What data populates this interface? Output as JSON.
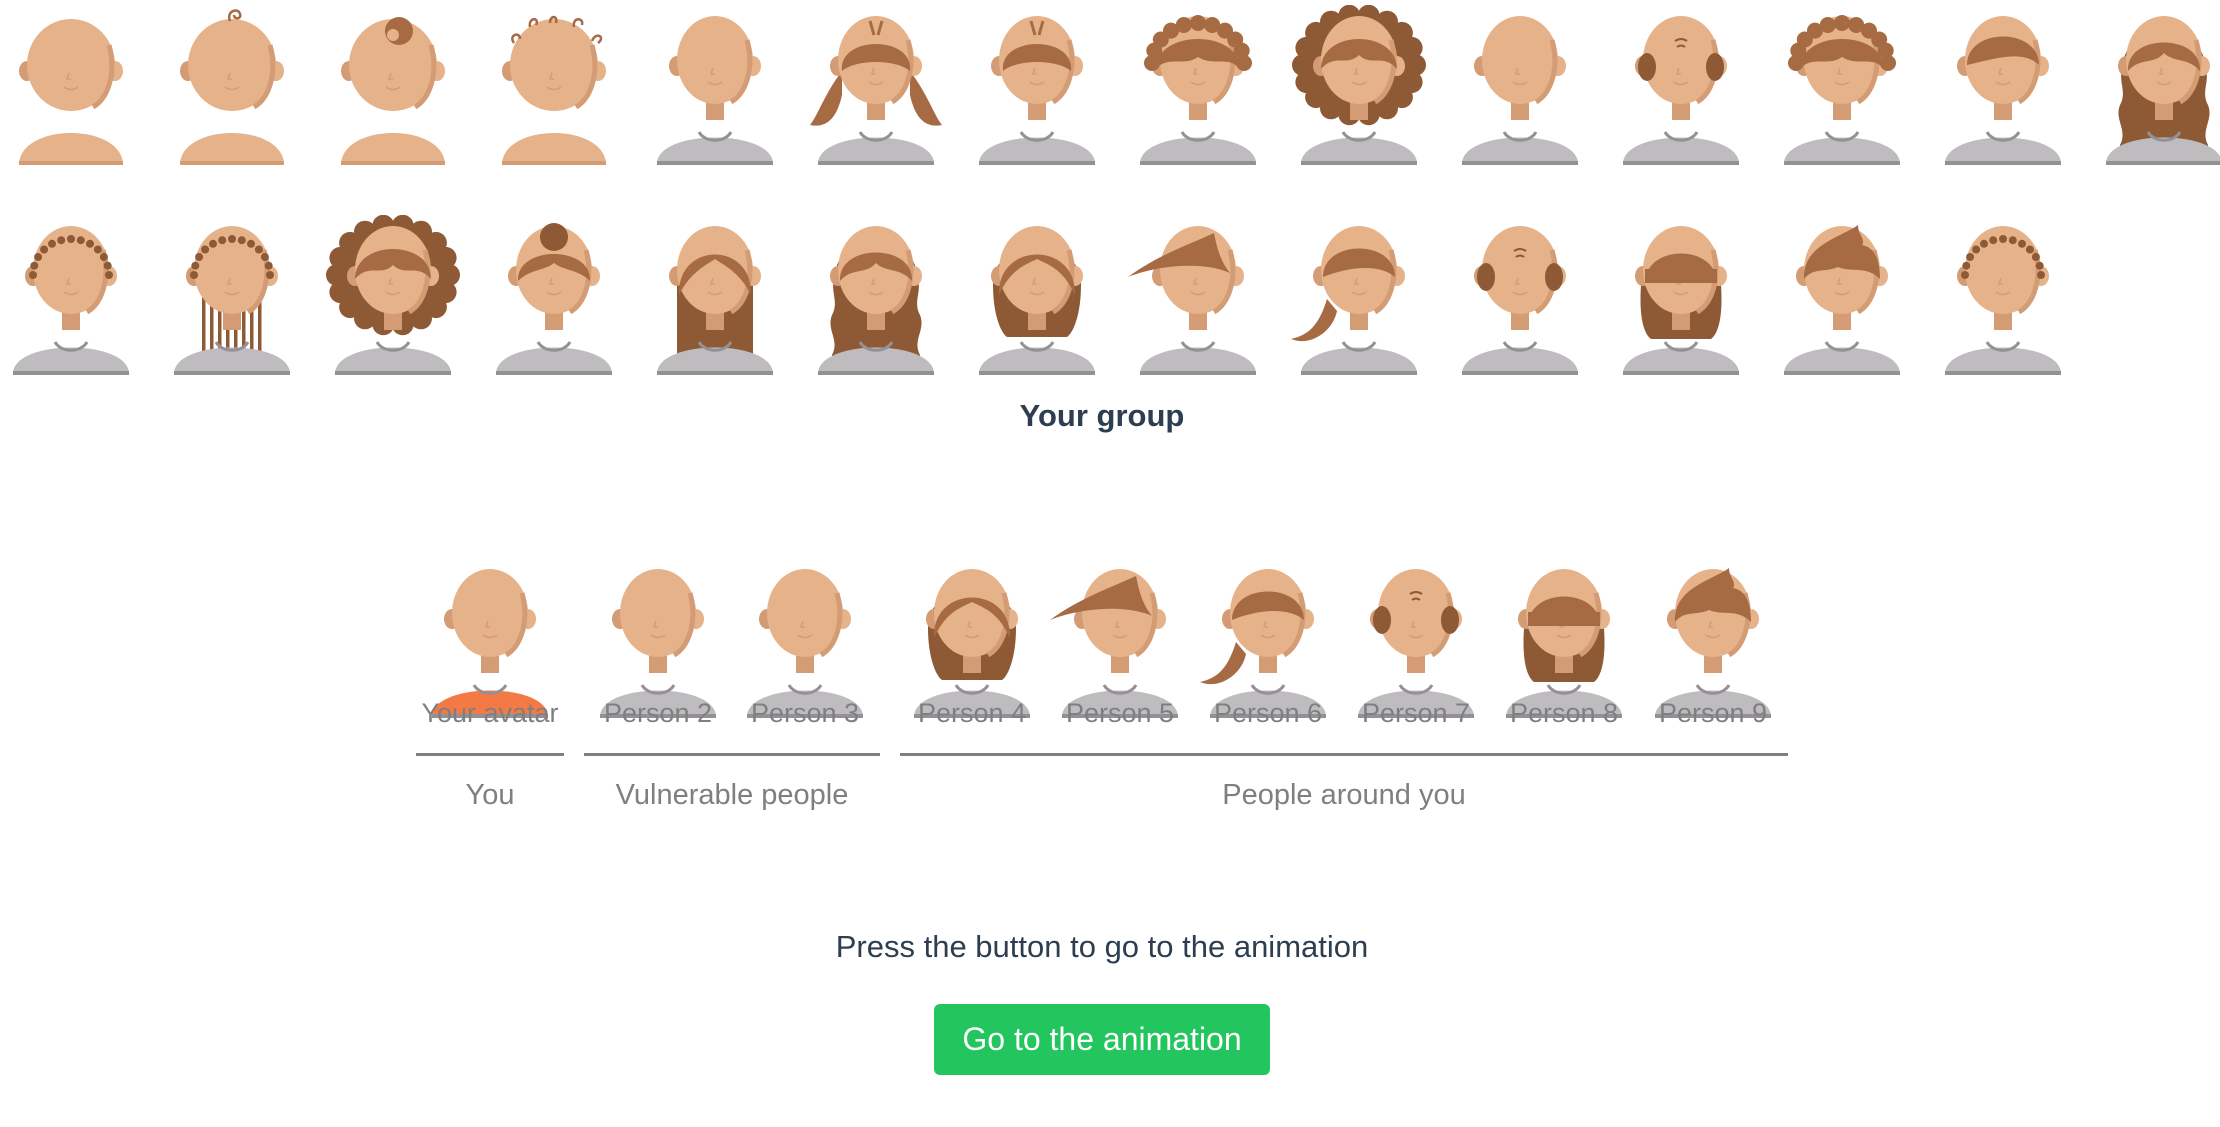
{
  "colors": {
    "skin": "#e5b28a",
    "skin_shadow": "#d49c74",
    "hair": "#a66b43",
    "hair_dark": "#8e5a36",
    "shirt": "#bfbcc0",
    "shirt_shadow": "#949196",
    "you_shirt": "#f47a45",
    "text_dark": "#2c3e50",
    "text_grey": "#7f7f7f",
    "button": "#22c55e"
  },
  "picker": {
    "row1": [
      {
        "hair": "none",
        "body": "baby"
      },
      {
        "hair": "curl",
        "body": "baby"
      },
      {
        "hair": "topknot",
        "body": "baby"
      },
      {
        "hair": "curls",
        "body": "baby"
      },
      {
        "hair": "none",
        "body": "adult"
      },
      {
        "hair": "pigtails",
        "body": "adult"
      },
      {
        "hair": "tuft",
        "body": "adult"
      },
      {
        "hair": "spiky",
        "body": "adult"
      },
      {
        "hair": "afro",
        "body": "adult"
      },
      {
        "hair": "none",
        "body": "adult"
      },
      {
        "hair": "balding",
        "body": "adult"
      },
      {
        "hair": "spiky",
        "body": "adult"
      },
      {
        "hair": "short",
        "body": "adult"
      },
      {
        "hair": "wavylong",
        "body": "adult"
      }
    ],
    "row2": [
      {
        "hair": "beads",
        "body": "adult"
      },
      {
        "hair": "braids",
        "body": "adult"
      },
      {
        "hair": "afro",
        "body": "adult"
      },
      {
        "hair": "bun",
        "body": "adult"
      },
      {
        "hair": "straightlong",
        "body": "adult"
      },
      {
        "hair": "wavylong",
        "body": "adult"
      },
      {
        "hair": "bob",
        "body": "adult"
      },
      {
        "hair": "quiff",
        "body": "adult"
      },
      {
        "hair": "ponytail",
        "body": "adult"
      },
      {
        "hair": "balding",
        "body": "adult"
      },
      {
        "hair": "bangs",
        "body": "adult"
      },
      {
        "hair": "messy",
        "body": "adult"
      },
      {
        "hair": "beads",
        "body": "adult"
      }
    ]
  },
  "group": {
    "title": "Your group",
    "members": [
      {
        "label": "Your avatar",
        "hair": "none",
        "you": true
      },
      {
        "label": "Person 2",
        "hair": "none"
      },
      {
        "label": "Person 3",
        "hair": "none"
      },
      {
        "label": "Person 4",
        "hair": "bob"
      },
      {
        "label": "Person 5",
        "hair": "quiff"
      },
      {
        "label": "Person 6",
        "hair": "ponytail"
      },
      {
        "label": "Person 7",
        "hair": "balding"
      },
      {
        "label": "Person 8",
        "hair": "bangs"
      },
      {
        "label": "Person 9",
        "hair": "messy"
      }
    ],
    "brackets": [
      {
        "label": "You"
      },
      {
        "label": "Vulnerable people"
      },
      {
        "label": "People around you"
      }
    ]
  },
  "prompt": "Press the button to go to the animation",
  "button_label": "Go to the animation"
}
